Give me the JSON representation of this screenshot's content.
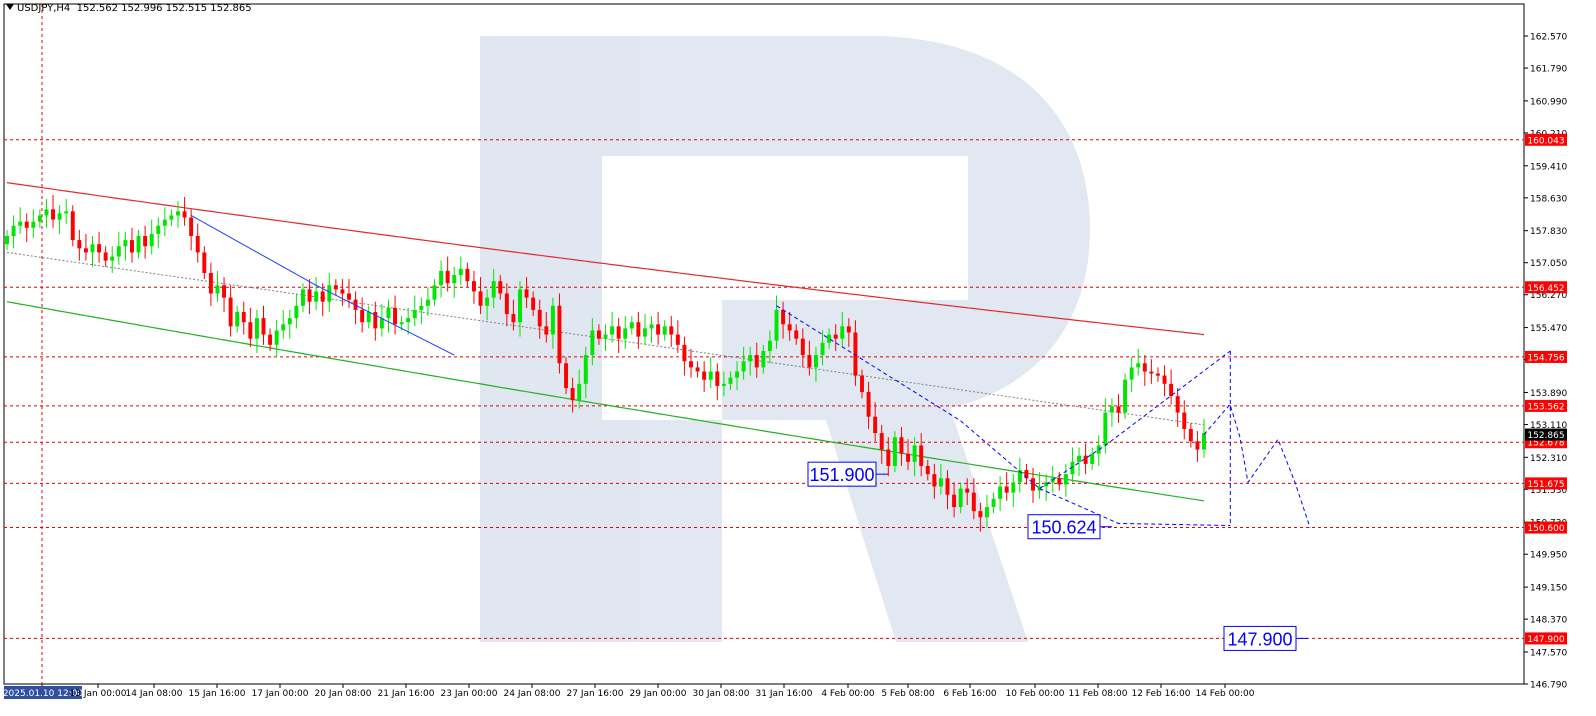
{
  "header": {
    "symbol_timeframe": "USDJPY,H4",
    "ohlc": "152.562 152.996 152.515 152.865"
  },
  "colors": {
    "bull": "#00e600",
    "bear": "#ff0000",
    "grid": "#000000",
    "level_line": "#e00000",
    "label_bg": "#ff0000",
    "current_label_bg": "#000000",
    "ma_red": "#e22b2b",
    "ma_green": "#22b222",
    "trend_gray": "#808080",
    "forecast_blue": "#0000ff",
    "watermark": "#d7e0ec"
  },
  "chart_data": {
    "type": "candlestick",
    "title": "USDJPY,H4",
    "y_axis": {
      "min": 146.79,
      "max": 163.35,
      "ticks": [
        "162.570",
        "161.790",
        "160.990",
        "160.210",
        "159.410",
        "158.630",
        "157.830",
        "157.050",
        "156.270",
        "155.470",
        "154.690",
        "153.890",
        "153.110",
        "152.310",
        "151.530",
        "150.730",
        "149.950",
        "149.150",
        "148.370",
        "147.570",
        "146.790"
      ]
    },
    "x_axis": {
      "ticks": [
        "2025.01.10 12:00",
        "13 Jan 00:00",
        "14 Jan 08:00",
        "15 Jan 16:00",
        "17 Jan 00:00",
        "20 Jan 08:00",
        "21 Jan 16:00",
        "23 Jan 00:00",
        "24 Jan 08:00",
        "27 Jan 16:00",
        "29 Jan 00:00",
        "30 Jan 08:00",
        "31 Jan 16:00",
        "4 Feb 00:00",
        "5 Feb 08:00",
        "6 Feb 16:00",
        "10 Feb 00:00",
        "11 Feb 08:00",
        "12 Feb 16:00",
        "14 Feb 00:00"
      ],
      "highlighted": "2025.01.10 12:00"
    },
    "price_levels": [
      {
        "value": 160.043,
        "label": "160.043"
      },
      {
        "value": 156.452,
        "label": "156.452"
      },
      {
        "value": 154.756,
        "label": "154.756"
      },
      {
        "value": 153.562,
        "label": "153.562"
      },
      {
        "value": 152.678,
        "label": "152.678"
      },
      {
        "value": 151.675,
        "label": "151.675"
      },
      {
        "value": 150.6,
        "label": "150.600"
      },
      {
        "value": 147.9,
        "label": "147.900"
      }
    ],
    "current_price": {
      "value": 152.865,
      "label": "152.865"
    },
    "callouts": [
      {
        "label": "151.900",
        "value": 151.9
      },
      {
        "label": "150.624",
        "value": 150.62
      },
      {
        "label": "147.900",
        "value": 147.9
      }
    ],
    "closes": [
      157.7,
      157.95,
      158.05,
      157.9,
      158.05,
      158.2,
      158.35,
      158.1,
      158.25,
      158.3,
      157.6,
      157.4,
      157.3,
      157.5,
      157.3,
      157.1,
      157.2,
      157.45,
      157.6,
      157.3,
      157.7,
      157.45,
      157.75,
      157.95,
      158.1,
      158.2,
      158.3,
      158.15,
      157.7,
      157.3,
      156.8,
      156.3,
      156.5,
      156.2,
      155.5,
      155.85,
      155.6,
      155.2,
      155.7,
      155.3,
      155.05,
      155.4,
      155.55,
      155.7,
      156.0,
      156.4,
      156.1,
      156.35,
      156.1,
      156.5,
      156.4,
      156.3,
      156.15,
      155.9,
      155.6,
      155.85,
      155.45,
      155.7,
      155.95,
      155.55,
      155.6,
      155.7,
      155.9,
      156.0,
      156.15,
      156.5,
      156.85,
      156.55,
      156.75,
      156.9,
      156.6,
      156.35,
      156.0,
      156.2,
      156.6,
      156.3,
      155.8,
      155.6,
      156.4,
      156.2,
      155.9,
      155.5,
      155.3,
      156.0,
      154.6,
      154.0,
      153.7,
      154.1,
      154.8,
      155.4,
      155.2,
      155.3,
      155.5,
      155.2,
      155.45,
      155.6,
      155.25,
      155.45,
      155.55,
      155.3,
      155.5,
      155.3,
      155.05,
      154.65,
      154.5,
      154.4,
      154.2,
      154.4,
      154.05,
      154.1,
      154.25,
      154.4,
      154.65,
      154.8,
      154.5,
      154.9,
      155.15,
      155.9,
      155.55,
      155.4,
      155.2,
      154.8,
      154.5,
      154.8,
      155.1,
      155.3,
      155.2,
      155.5,
      155.35,
      154.3,
      153.9,
      153.3,
      152.9,
      152.5,
      152.1,
      152.8,
      152.4,
      152.2,
      152.6,
      152.1,
      151.9,
      151.6,
      151.8,
      151.4,
      151.1,
      151.55,
      151.45,
      151.0,
      150.85,
      151.1,
      151.3,
      151.6,
      151.45,
      151.7,
      152.0,
      151.8,
      151.5,
      151.6,
      151.7,
      151.8,
      151.65,
      151.9,
      152.2,
      152.35,
      152.15,
      152.4,
      152.6,
      153.4,
      153.55,
      153.4,
      154.2,
      154.5,
      154.6,
      154.4,
      154.35,
      154.3,
      154.1,
      153.8,
      153.4,
      153.0,
      152.7,
      152.5,
      152.9
    ],
    "forecast_path": [
      {
        "x": "14 Feb 00:00",
        "y": 152.865
      },
      {
        "label_ref": "after 14 Feb",
        "y": 153.6
      },
      {
        "y": 152.8
      },
      {
        "y": 151.7
      },
      {
        "y": 152.75
      },
      {
        "y": 151.7
      },
      {
        "y": 150.6
      }
    ],
    "watermark": "R"
  }
}
